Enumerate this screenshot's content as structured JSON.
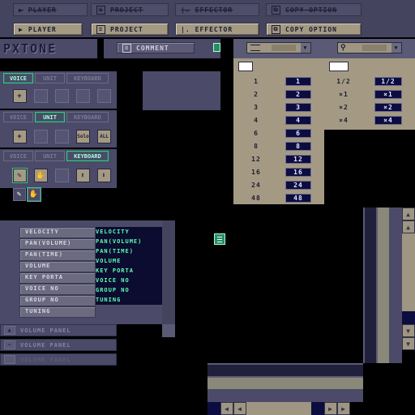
{
  "top_buttons_disabled": [
    {
      "label": "PLAYER",
      "icon": "play-icon"
    },
    {
      "label": "PROJECT",
      "icon": "document-icon"
    },
    {
      "label": "EFFECTOR",
      "icon": "bars-icon"
    },
    {
      "label": "COPY OPTION",
      "icon": "copy-icon"
    }
  ],
  "top_buttons": [
    {
      "label": "PLAYER",
      "icon": "play-icon"
    },
    {
      "label": "PROJECT",
      "icon": "document-icon"
    },
    {
      "label": "EFFECTOR",
      "icon": "bars-icon"
    },
    {
      "label": "COPY OPTION",
      "icon": "copy-icon"
    }
  ],
  "logo_text": "PXTONE",
  "comment_label": "COMMENT",
  "tabs": {
    "voice": "VOICE",
    "unit": "UNIT",
    "keyboard": "KEYBOARD"
  },
  "unit_tools": {
    "solo": "Solo",
    "all": "ALL"
  },
  "zoom_values": [
    "1",
    "2",
    "3",
    "4",
    "6",
    "8",
    "12",
    "16",
    "24",
    "48"
  ],
  "scale_values": [
    "1/2",
    "×1",
    "×2",
    "×4"
  ],
  "param_headers": [
    "VELOCITY",
    "PAN(VOLUME)",
    "PAN(TIME)",
    "VOLUME",
    "KEY PORTA",
    "VOICE NO",
    "GROUP NO",
    "TUNING"
  ],
  "param_values": [
    "VELOCITY",
    "PAN(VOLUME)",
    "PAN(TIME)",
    "VOLUME",
    "KEY PORTA",
    "VOICE NO",
    "GROUP NO",
    "TUNING"
  ],
  "volume_panel": [
    "VOLUME PANEL",
    "VOLUME PANEL",
    "VOLUME PANEL"
  ],
  "colors": {
    "panel": "#4b4a68",
    "tan": "#a49a84",
    "dark": "#0c0c30",
    "accent_green": "#3fc08a",
    "value_green": "#5cffb4"
  }
}
